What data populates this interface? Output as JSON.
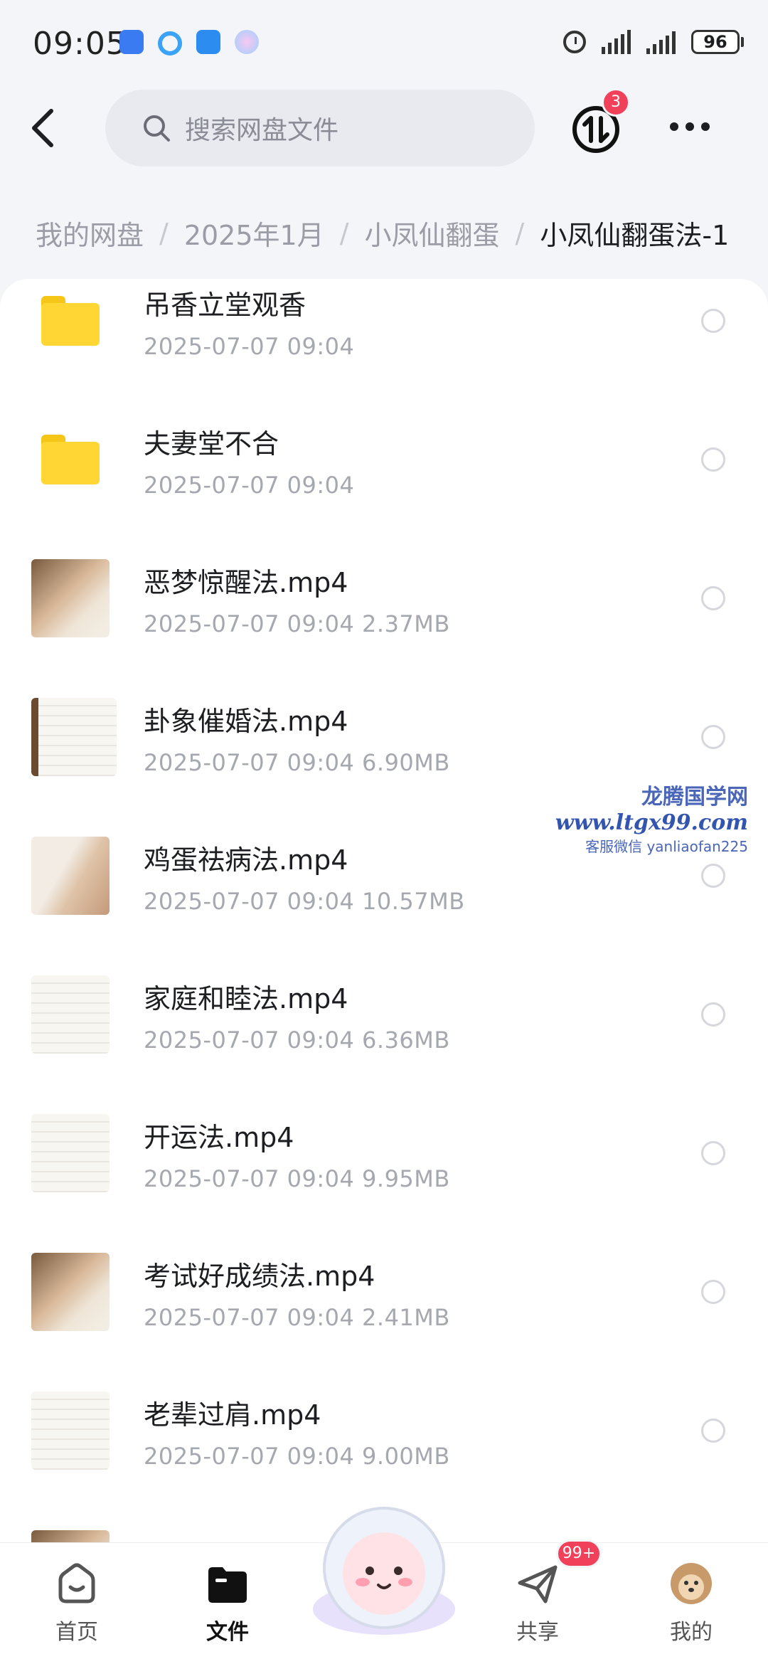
{
  "status_bar": {
    "time": "09:05",
    "battery": "96",
    "icons": [
      "app-notification-icon",
      "browser-icon",
      "cloud-app-icon",
      "assistant-icon",
      "alarm-icon",
      "signal-icon",
      "signal-icon"
    ]
  },
  "header": {
    "search_placeholder": "搜索网盘文件",
    "transfer_badge": "3"
  },
  "breadcrumb": [
    "我的网盘",
    "2025年1月",
    "小凤仙翻蛋",
    "小凤仙翻蛋法-1"
  ],
  "files": [
    {
      "name": "吊香立堂观香",
      "meta": "2025-07-07  09:04",
      "type": "folder"
    },
    {
      "name": "夫妻堂不合",
      "meta": "2025-07-07  09:04",
      "type": "folder"
    },
    {
      "name": "恶梦惊醒法.mp4",
      "meta": "2025-07-07  09:04   2.37MB",
      "type": "video"
    },
    {
      "name": "卦象催婚法.mp4",
      "meta": "2025-07-07  09:04   6.90MB",
      "type": "video"
    },
    {
      "name": "鸡蛋祛病法.mp4",
      "meta": "2025-07-07  09:04   10.57MB",
      "type": "video"
    },
    {
      "name": "家庭和睦法.mp4",
      "meta": "2025-07-07  09:04   6.36MB",
      "type": "video"
    },
    {
      "name": "开运法.mp4",
      "meta": "2025-07-07  09:04   9.95MB",
      "type": "video"
    },
    {
      "name": "考试好成绩法.mp4",
      "meta": "2025-07-07  09:04   2.41MB",
      "type": "video"
    },
    {
      "name": "老辈过肩.mp4",
      "meta": "2025-07-07  09:04   9.00MB",
      "type": "video"
    }
  ],
  "watermark": {
    "line1": "龙腾国学网",
    "line2": "www.ltgx99.com",
    "line3": "客服微信 yanliaofan225"
  },
  "nav": {
    "home": "首页",
    "files": "文件",
    "share": "共享",
    "share_badge": "99+",
    "mine": "我的"
  },
  "colors": {
    "accent_red": "#f0405a",
    "folder_yellow": "#ffd633",
    "background": "#f4f5f9"
  }
}
